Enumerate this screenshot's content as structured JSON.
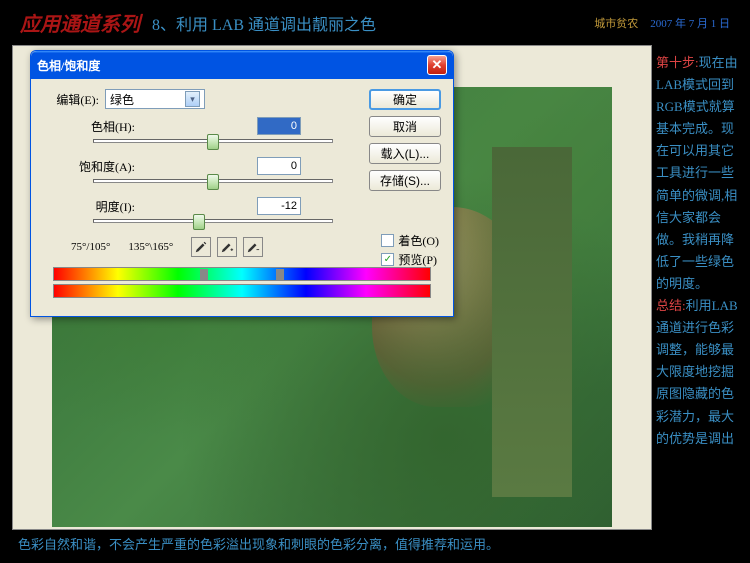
{
  "header": {
    "title": "应用通道系列",
    "subtitle": "8、利用 LAB 通道调出靓丽之色",
    "author": "城市贫农",
    "date": "2007 年 7 月 1 日"
  },
  "dialog": {
    "title": "色相/饱和度",
    "edit_label": "编辑(E):",
    "edit_value": "绿色",
    "hue_label": "色相(H):",
    "hue_value": "0",
    "sat_label": "饱和度(A):",
    "sat_value": "0",
    "light_label": "明度(I):",
    "light_value": "-12",
    "range_left": "75°/105°",
    "range_right": "135°\\165°",
    "buttons": {
      "ok": "确定",
      "cancel": "取消",
      "load": "载入(L)...",
      "save": "存储(S)..."
    },
    "colorize_label": "着色(O)",
    "preview_label": "预览(P)"
  },
  "sidetext": {
    "step": "第十步:",
    "body1": "现在由LAB模式回到RGB模式就算基本完成。现在可以用其它工具进行一些简单的微调,相信大家都会做。我稍再降低了一些绿色的明度。",
    "summ": "总结:",
    "body2": "利用LAB通道进行色彩调整，能够最大限度地挖掘原图隐藏的色彩潜力，最大的优势是调出"
  },
  "bottomtext": "色彩自然和谐，不会产生严重的色彩溢出现象和刺眼的色彩分离，值得推荐和运用。"
}
